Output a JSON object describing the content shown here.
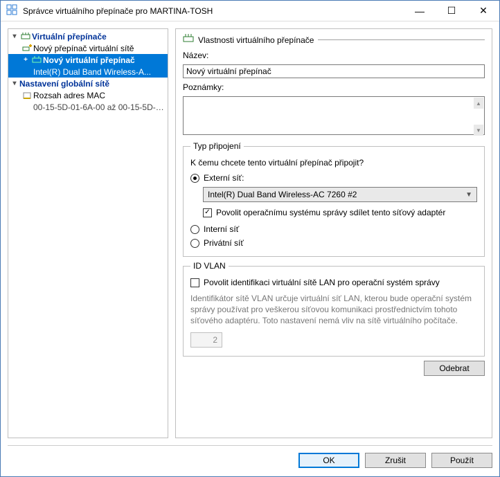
{
  "window": {
    "title": "Správce virtuálního přepínače pro MARTINA-TOSH"
  },
  "tree": {
    "virtual_switches": "Virtuální přepínače",
    "new_switch_net": "Nový přepínač virtuální sítě",
    "new_virtual_switch": "Nový virtuální přepínač",
    "new_virtual_switch_sub": "Intel(R) Dual Band Wireless-A...",
    "global_settings": "Nastavení globální sítě",
    "mac_range": "Rozsah adres MAC",
    "mac_range_value": "00-15-5D-01-6A-00 až 00-15-5D-0..."
  },
  "props": {
    "header": "Vlastnosti virtuálního přepínače",
    "name_label": "Název:",
    "name_value": "Nový virtuální přepínač",
    "notes_label": "Poznámky:",
    "notes_value": ""
  },
  "conn": {
    "legend": "Typ připojení",
    "question": "K čemu chcete tento virtuální přepínač připojit?",
    "external": "Externí síť:",
    "adapter_selected": "Intel(R) Dual Band Wireless-AC 7260 #2",
    "allow_mgmt": "Povolit operačnímu systému správy sdílet tento síťový adaptér",
    "internal": "Interní síť",
    "private": "Privátní síť"
  },
  "vlan": {
    "legend": "ID VLAN",
    "enable": "Povolit identifikaci virtuální sítě LAN pro operační systém správy",
    "desc": "Identifikátor sítě VLAN určuje virtuální síť LAN, kterou bude operační systém správy používat pro veškerou síťovou komunikaci prostřednictvím tohoto síťového adaptéru. Toto nastavení nemá vliv na sítě virtuálního počítače.",
    "value": "2"
  },
  "buttons": {
    "remove": "Odebrat",
    "ok": "OK",
    "cancel": "Zrušit",
    "apply": "Použít"
  }
}
